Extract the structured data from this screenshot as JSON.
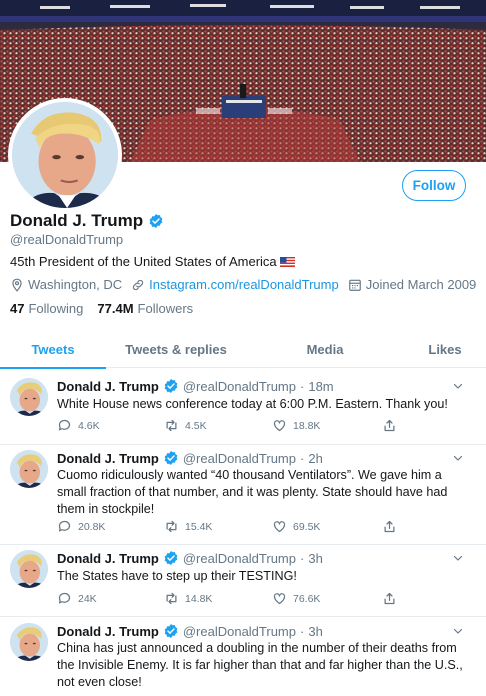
{
  "profile": {
    "name": "Donald J. Trump",
    "handle": "@realDonaldTrump",
    "bio": "45th President of the United States of America",
    "location": "Washington, DC",
    "website": "Instagram.com/realDonaldTrump",
    "joined": "Joined March 2009",
    "following_count": "47",
    "following_label": "Following",
    "followers_count": "77.4M",
    "followers_label": "Followers",
    "follow_label": "Follow"
  },
  "tabs": [
    {
      "label": "Tweets",
      "active": true
    },
    {
      "label": "Tweets & replies",
      "active": false
    },
    {
      "label": "Media",
      "active": false
    },
    {
      "label": "Likes",
      "active": false
    }
  ],
  "tweets": [
    {
      "name": "Donald J. Trump",
      "handle": "@realDonaldTrump",
      "dot": "·",
      "time": "18m",
      "text": "White House news conference today at 6:00 P.M. Eastern. Thank you!",
      "replies": "4.6K",
      "retweets": "4.5K",
      "likes": "18.8K"
    },
    {
      "name": "Donald J. Trump",
      "handle": "@realDonaldTrump",
      "dot": "·",
      "time": "2h",
      "text": "Cuomo ridiculously wanted “40 thousand Ventilators”. We gave him a small fraction of that number, and it was plenty. State should have had them in stockpile!",
      "replies": "20.8K",
      "retweets": "15.4K",
      "likes": "69.5K"
    },
    {
      "name": "Donald J. Trump",
      "handle": "@realDonaldTrump",
      "dot": "·",
      "time": "3h",
      "text": "The States have to step up their TESTING!",
      "replies": "24K",
      "retweets": "14.8K",
      "likes": "76.6K"
    },
    {
      "name": "Donald J. Trump",
      "handle": "@realDonaldTrump",
      "dot": "·",
      "time": "3h",
      "text": "China has just announced a doubling in the number of their deaths from the Invisible Enemy. It is far higher than that and far higher than the U.S., not even close!",
      "replies": "",
      "retweets": "",
      "likes": ""
    }
  ],
  "colors": {
    "accent": "#1da1f2",
    "link": "#1b95e0",
    "secondary_text": "#657786",
    "border": "#e6ecf0"
  },
  "icons": {
    "verified": "verified-badge-icon",
    "location": "location-pin-icon",
    "link": "link-icon",
    "calendar": "calendar-icon",
    "reply": "reply-icon",
    "retweet": "retweet-icon",
    "like": "heart-icon",
    "share": "share-icon",
    "caret": "chevron-down-icon",
    "flag": "us-flag-icon"
  }
}
